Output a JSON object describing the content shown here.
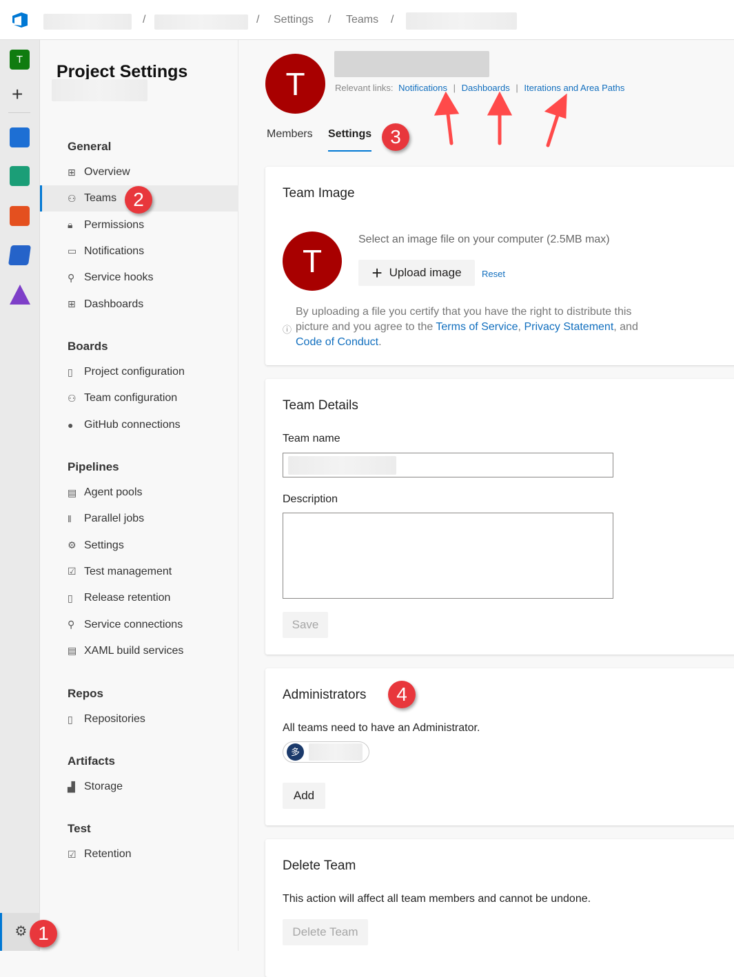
{
  "breadcrumb": {
    "items": [
      "Settings",
      "Teams"
    ],
    "separator": "/"
  },
  "rail": {
    "project_initial": "T",
    "items": [
      "boards-icon",
      "test-plans-check-icon",
      "repos-icon",
      "pipelines-icon",
      "artifacts-icon"
    ]
  },
  "sidebar": {
    "title": "Project Settings",
    "sections": [
      {
        "title": "General",
        "items": [
          {
            "label": "Overview",
            "icon": "overview-icon"
          },
          {
            "label": "Teams",
            "icon": "teams-icon",
            "selected": true
          },
          {
            "label": "Permissions",
            "icon": "lock-icon"
          },
          {
            "label": "Notifications",
            "icon": "chat-icon"
          },
          {
            "label": "Service hooks",
            "icon": "plug-icon"
          },
          {
            "label": "Dashboards",
            "icon": "dashboard-icon"
          }
        ]
      },
      {
        "title": "Boards",
        "items": [
          {
            "label": "Project configuration",
            "icon": "doc-gear-icon"
          },
          {
            "label": "Team configuration",
            "icon": "team-gear-icon"
          },
          {
            "label": "GitHub connections",
            "icon": "github-icon"
          }
        ]
      },
      {
        "title": "Pipelines",
        "items": [
          {
            "label": "Agent pools",
            "icon": "agent-icon"
          },
          {
            "label": "Parallel jobs",
            "icon": "parallel-icon"
          },
          {
            "label": "Settings",
            "icon": "gear-icon"
          },
          {
            "label": "Test management",
            "icon": "test-icon"
          },
          {
            "label": "Release retention",
            "icon": "phone-icon"
          },
          {
            "label": "Service connections",
            "icon": "plug-icon"
          },
          {
            "label": "XAML build services",
            "icon": "agent-icon"
          }
        ]
      },
      {
        "title": "Repos",
        "items": [
          {
            "label": "Repositories",
            "icon": "repo-icon"
          }
        ]
      },
      {
        "title": "Artifacts",
        "items": [
          {
            "label": "Storage",
            "icon": "chart-icon"
          }
        ]
      },
      {
        "title": "Test",
        "items": [
          {
            "label": "Retention",
            "icon": "test-icon"
          }
        ]
      }
    ]
  },
  "header": {
    "initial": "T",
    "relevant_label": "Relevant links:",
    "links": [
      "Notifications",
      "Dashboards",
      "Iterations and Area Paths"
    ],
    "link_sep": "|",
    "tabs": [
      {
        "label": "Members"
      },
      {
        "label": "Settings",
        "active": true
      }
    ]
  },
  "team_image": {
    "title": "Team Image",
    "initial": "T",
    "hint": "Select an image file on your computer (2.5MB max)",
    "upload": "Upload image",
    "reset": "Reset",
    "cert_1": "By uploading a file you certify that you have the right to distribute this picture and you agree to the ",
    "tos": "Terms of Service",
    "comma": ", ",
    "privacy": "Privacy Statement",
    "and": ", and ",
    "coc": "Code of Conduct",
    "period": "."
  },
  "team_details": {
    "title": "Team Details",
    "name_label": "Team name",
    "desc_label": "Description",
    "save": "Save"
  },
  "admins": {
    "title": "Administrators",
    "note": "All teams need to have an Administrator.",
    "avatar_glyph": "多",
    "add": "Add"
  },
  "delete": {
    "title": "Delete Team",
    "note": "This action will affect all team members and cannot be undone.",
    "button": "Delete Team"
  },
  "annotations": [
    "1",
    "2",
    "3",
    "4"
  ],
  "colors": {
    "accent": "#0078d4",
    "avatar": "#a80000",
    "annotation": "#e8373c",
    "link": "#106ebe"
  }
}
